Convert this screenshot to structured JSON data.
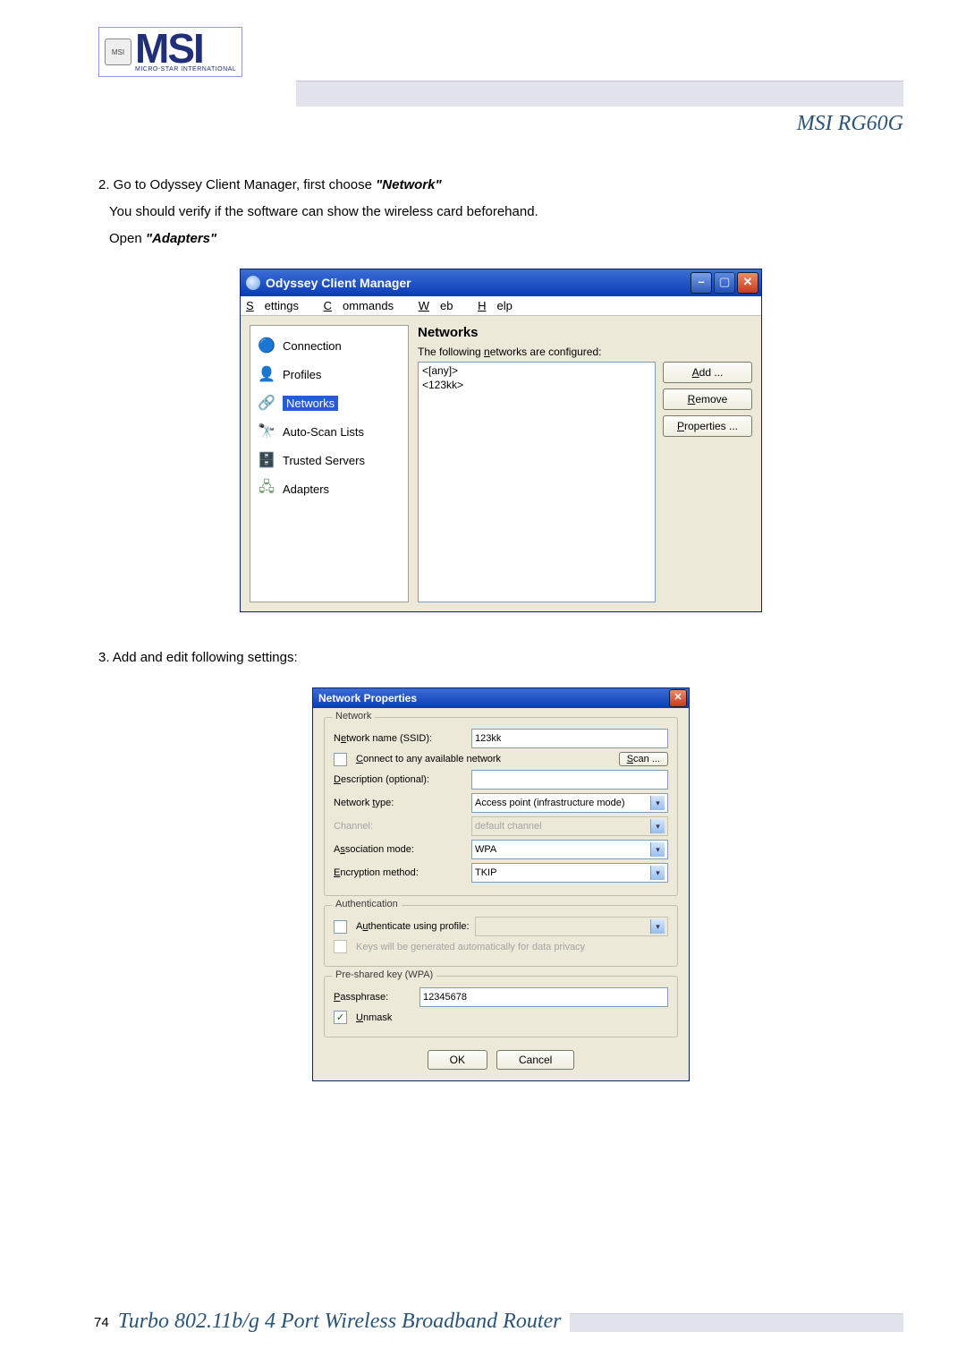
{
  "header": {
    "logo_badge": "MSI",
    "logo_text": "MSI",
    "logo_sub": "MICRO-STAR INTERNATIONAL",
    "product": "MSI RG60G"
  },
  "body": {
    "step2_a": "2. Go to Odyssey Client Manager, first choose ",
    "step2_b": "\"Network\"",
    "step2_line2": "You should verify if the software can show the wireless card beforehand.",
    "step2_line3a": "Open ",
    "step2_line3b": "\"Adapters\"",
    "step3": "3. Add and edit following settings:"
  },
  "win1": {
    "title": "Odyssey Client Manager",
    "menu": {
      "settings": "Settings",
      "commands": "Commands",
      "web": "Web",
      "help": "Help"
    },
    "sidebar": {
      "connection": "Connection",
      "profiles": "Profiles",
      "networks": "Networks",
      "autoscan": "Auto-Scan Lists",
      "trusted": "Trusted Servers",
      "adapters": "Adapters"
    },
    "content": {
      "heading": "Networks",
      "sub": "The following networks are configured:",
      "items": [
        "<[any]>",
        "<123kk>"
      ]
    },
    "buttons": {
      "add": "Add ...",
      "remove": "Remove",
      "props": "Properties ..."
    }
  },
  "win2": {
    "title": "Network Properties",
    "group_network": "Network",
    "ssid_label": "Network name (SSID):",
    "ssid_value": "123kk",
    "connect_any": "Connect to any available network",
    "scan": "Scan ...",
    "desc_label": "Description (optional):",
    "desc_value": "",
    "type_label": "Network type:",
    "type_value": "Access point (infrastructure mode)",
    "channel_label": "Channel:",
    "channel_value": "default channel",
    "assoc_label": "Association mode:",
    "assoc_value": "WPA",
    "enc_label": "Encryption method:",
    "enc_value": "TKIP",
    "group_auth": "Authentication",
    "auth_profile": "Authenticate using profile:",
    "keys_auto": "Keys will be generated automatically for data privacy",
    "group_psk": "Pre-shared key (WPA)",
    "pass_label": "Passphrase:",
    "pass_value": "12345678",
    "unmask": "Unmask",
    "ok": "OK",
    "cancel": "Cancel"
  },
  "footer": {
    "page": "74",
    "title": "Turbo 802.11b/g 4 Port Wireless Broadband Router"
  }
}
